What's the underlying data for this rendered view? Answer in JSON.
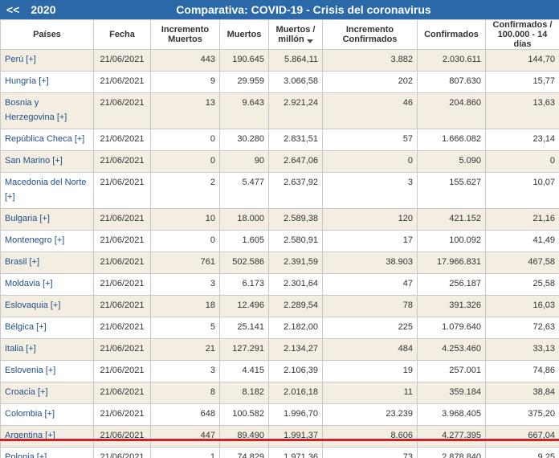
{
  "header": {
    "prev_label": "<<",
    "year": "2020",
    "title": "Comparativa: COVID-19 - Crisis del coronavirus"
  },
  "columns": [
    "Países",
    "Fecha",
    "Incremento Muertos",
    "Muertos",
    "Muertos / millón",
    "Incremento Confirmados",
    "Confirmados",
    "Confirmados / 100.000 - 14 días"
  ],
  "rows": [
    {
      "country": "Perú [+]",
      "date": "21/06/2021",
      "inc_deaths": "443",
      "deaths": "190.645",
      "deaths_m": "5.864,11",
      "inc_conf": "3.882",
      "conf": "2.030.611",
      "conf_100k": "144,70"
    },
    {
      "country": "Hungría [+]",
      "date": "21/06/2021",
      "inc_deaths": "9",
      "deaths": "29.959",
      "deaths_m": "3.066,58",
      "inc_conf": "202",
      "conf": "807.630",
      "conf_100k": "15,77"
    },
    {
      "country": "Bosnia y Herzegovina [+]",
      "date": "21/06/2021",
      "inc_deaths": "13",
      "deaths": "9.643",
      "deaths_m": "2.921,24",
      "inc_conf": "46",
      "conf": "204.860",
      "conf_100k": "13,63"
    },
    {
      "country": "República Checa [+]",
      "date": "21/06/2021",
      "inc_deaths": "0",
      "deaths": "30.280",
      "deaths_m": "2.831,51",
      "inc_conf": "57",
      "conf": "1.666.082",
      "conf_100k": "23,14"
    },
    {
      "country": "San Marino [+]",
      "date": "21/06/2021",
      "inc_deaths": "0",
      "deaths": "90",
      "deaths_m": "2.647,06",
      "inc_conf": "0",
      "conf": "5.090",
      "conf_100k": "0"
    },
    {
      "country": "Macedonia del Norte [+]",
      "date": "21/06/2021",
      "inc_deaths": "2",
      "deaths": "5.477",
      "deaths_m": "2.637,92",
      "inc_conf": "3",
      "conf": "155.627",
      "conf_100k": "10,07"
    },
    {
      "country": "Bulgaria [+]",
      "date": "21/06/2021",
      "inc_deaths": "10",
      "deaths": "18.000",
      "deaths_m": "2.589,38",
      "inc_conf": "120",
      "conf": "421.152",
      "conf_100k": "21,16"
    },
    {
      "country": "Montenegro [+]",
      "date": "21/06/2021",
      "inc_deaths": "0",
      "deaths": "1.605",
      "deaths_m": "2.580,91",
      "inc_conf": "17",
      "conf": "100.092",
      "conf_100k": "41,49"
    },
    {
      "country": "Brasil [+]",
      "date": "21/06/2021",
      "inc_deaths": "761",
      "deaths": "502.586",
      "deaths_m": "2.391,59",
      "inc_conf": "38.903",
      "conf": "17.966.831",
      "conf_100k": "467,58"
    },
    {
      "country": "Moldavia [+]",
      "date": "21/06/2021",
      "inc_deaths": "3",
      "deaths": "6.173",
      "deaths_m": "2.301,64",
      "inc_conf": "47",
      "conf": "256.187",
      "conf_100k": "25,58"
    },
    {
      "country": "Eslovaquia [+]",
      "date": "21/06/2021",
      "inc_deaths": "18",
      "deaths": "12.496",
      "deaths_m": "2.289,54",
      "inc_conf": "78",
      "conf": "391.326",
      "conf_100k": "16,03"
    },
    {
      "country": "Bélgica [+]",
      "date": "21/06/2021",
      "inc_deaths": "5",
      "deaths": "25.141",
      "deaths_m": "2.182,00",
      "inc_conf": "225",
      "conf": "1.079.640",
      "conf_100k": "72,63"
    },
    {
      "country": "Italia [+]",
      "date": "21/06/2021",
      "inc_deaths": "21",
      "deaths": "127.291",
      "deaths_m": "2.134,27",
      "inc_conf": "484",
      "conf": "4.253.460",
      "conf_100k": "33,13"
    },
    {
      "country": "Eslovenia [+]",
      "date": "21/06/2021",
      "inc_deaths": "3",
      "deaths": "4.415",
      "deaths_m": "2.106,39",
      "inc_conf": "19",
      "conf": "257.001",
      "conf_100k": "74,86"
    },
    {
      "country": "Croacia [+]",
      "date": "21/06/2021",
      "inc_deaths": "8",
      "deaths": "8.182",
      "deaths_m": "2.016,18",
      "inc_conf": "11",
      "conf": "359.184",
      "conf_100k": "38,84"
    },
    {
      "country": "Colombia [+]",
      "date": "21/06/2021",
      "inc_deaths": "648",
      "deaths": "100.582",
      "deaths_m": "1.996,70",
      "inc_conf": "23.239",
      "conf": "3.968.405",
      "conf_100k": "375,20"
    },
    {
      "country": "Argentina [+]",
      "date": "21/06/2021",
      "inc_deaths": "447",
      "deaths": "89.490",
      "deaths_m": "1.991,37",
      "inc_conf": "8.606",
      "conf": "4.277.395",
      "conf_100k": "667,04"
    },
    {
      "country": "Polonia [+]",
      "date": "21/06/2021",
      "inc_deaths": "1",
      "deaths": "74.829",
      "deaths_m": "1.971,36",
      "inc_conf": "73",
      "conf": "2.878.840",
      "conf_100k": "9,25"
    }
  ],
  "colors": {
    "header_bg": "#2b69a8",
    "row_even": "#f3eee1",
    "row_odd": "#ffffff",
    "link": "#1f4e8c",
    "highlight_line": "#d0212a"
  },
  "icons": {
    "sort": "sort-desc-icon"
  }
}
